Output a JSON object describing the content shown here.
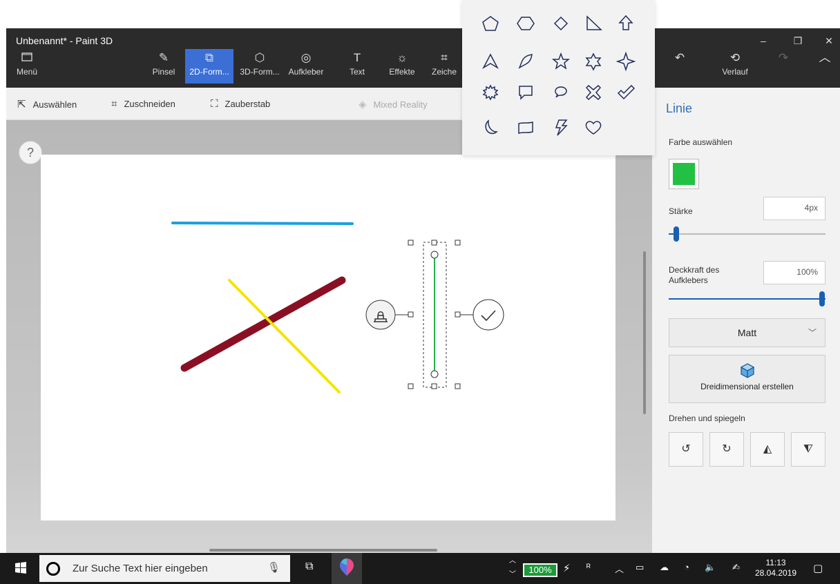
{
  "window": {
    "title": "Unbenannt* - Paint 3D",
    "controls": [
      "–",
      "❐",
      "✕"
    ]
  },
  "ribbon": {
    "menu_label": "Menü",
    "tabs": [
      {
        "label": "Pinsel",
        "icon": "brush-icon"
      },
      {
        "label": "2D-Form...",
        "icon": "2d-shapes-icon",
        "active": true
      },
      {
        "label": "3D-Form...",
        "icon": "3d-shapes-icon"
      },
      {
        "label": "Aufkleber",
        "icon": "sticker-icon"
      },
      {
        "label": "Text",
        "icon": "text-icon"
      },
      {
        "label": "Effekte",
        "icon": "effects-icon"
      },
      {
        "label": "Zeiche",
        "icon": "canvas-icon"
      }
    ],
    "undo_icon": "undo-icon",
    "history_label": "Verlauf",
    "redo_icon": "redo-icon",
    "collapse_icon": "chevron-up-icon"
  },
  "toolbar": {
    "select_label": "Auswählen",
    "crop_label": "Zuschneiden",
    "magic_select_label": "Zauberstab",
    "mixed_reality_label": "Mixed Reality"
  },
  "help_label": "?",
  "canvas": {
    "lines": [
      {
        "name": "blue-line",
        "color": "#1aa0e0"
      },
      {
        "name": "maroon-line",
        "color": "#8b0f23"
      },
      {
        "name": "yellow-line",
        "color": "#f5e400"
      },
      {
        "name": "green-line",
        "color": "#22b14c"
      }
    ]
  },
  "panel": {
    "title": "Linie",
    "color_label": "Farbe auswählen",
    "selected_color": "#22c043",
    "thickness_label": "Stärke",
    "thickness_value": "4px",
    "opacity_label_line1": "Deckkraft des",
    "opacity_label_line2": "Aufklebers",
    "opacity_value": "100%",
    "finish_value": "Matt",
    "make3d_label": "Dreidimensional erstellen",
    "rotate_label": "Drehen und spiegeln"
  },
  "shapes": [
    "pentagon",
    "hexagon",
    "diamond",
    "right-triangle",
    "arrow-up",
    "triangle",
    "leaf",
    "star-5",
    "star-6",
    "star-4",
    "burst",
    "callout-rect",
    "callout-round",
    "cross",
    "checkmark",
    "moon",
    "banner",
    "lightning",
    "heart"
  ],
  "taskbar": {
    "search_placeholder": "Zur Suche Text hier eingeben",
    "battery": "100%",
    "time": "11:13",
    "date": "28.04.2019"
  }
}
